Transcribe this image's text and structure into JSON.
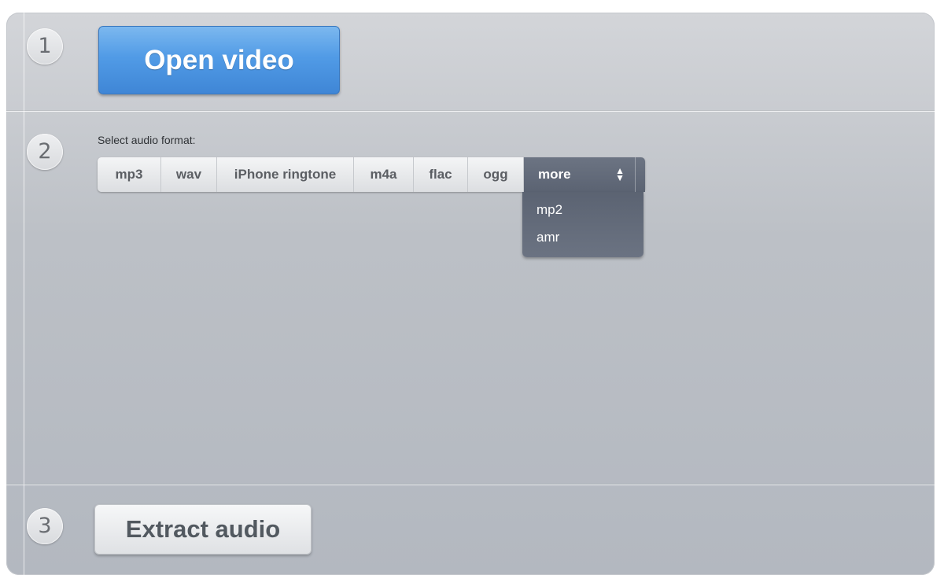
{
  "steps": {
    "step1": "1",
    "step2": "2",
    "step3": "3"
  },
  "open_button": {
    "label": "Open video"
  },
  "format": {
    "label": "Select audio format:",
    "options": [
      "mp3",
      "wav",
      "iPhone ringtone",
      "m4a",
      "flac",
      "ogg"
    ],
    "more_label": "more",
    "more_icon": "updown-arrows-icon",
    "dropdown_items": [
      "mp2",
      "amr"
    ]
  },
  "extract_button": {
    "label": "Extract audio"
  },
  "colors": {
    "accent_blue": "#4a91e0",
    "selected_dark": "#606878"
  }
}
